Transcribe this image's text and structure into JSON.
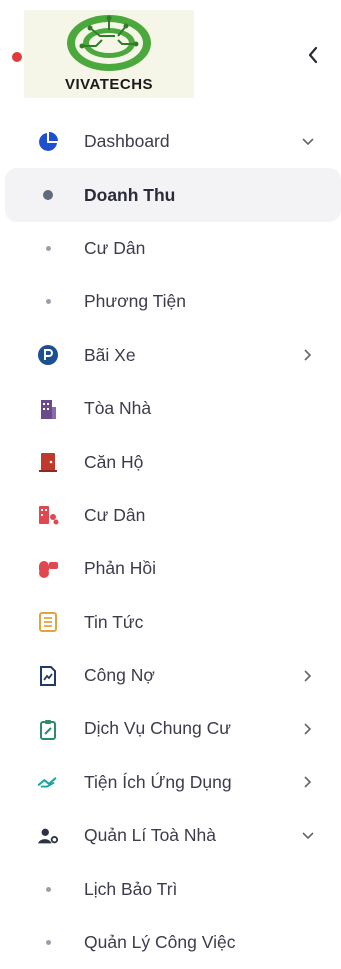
{
  "logo": {
    "text": "VIVATECHS"
  },
  "menu": {
    "dashboard": "Dashboard",
    "doanh_thu": "Doanh Thu",
    "cu_dan_sub": "Cư Dân",
    "phuong_tien": "Phương Tiện",
    "bai_xe": "Bãi Xe",
    "toa_nha": "Tòa Nhà",
    "can_ho": "Căn Hộ",
    "cu_dan": "Cư Dân",
    "phan_hoi": "Phản Hồi",
    "tin_tuc": "Tin Tức",
    "cong_no": "Công Nợ",
    "dich_vu": "Dịch Vụ Chung Cư",
    "tien_ich": "Tiện Ích Ứng Dụng",
    "quan_li": "Quản Lí Toà Nhà",
    "lich_bao_tri": "Lịch Bảo Trì",
    "quan_ly_cong_viec": "Quản Lý Công Việc"
  },
  "colors": {
    "dashboard": "#1e4fd0",
    "parking": "#1d4f91",
    "building": "#6a4a8a",
    "apartment": "#c0392b",
    "residents": "#e0484f",
    "feedback": "#e0484f",
    "news": "#e6a23c",
    "debt": "#1f3b6b",
    "service": "#2d8a6a",
    "utility": "#1aa3a3",
    "manage": "#2b3445"
  }
}
